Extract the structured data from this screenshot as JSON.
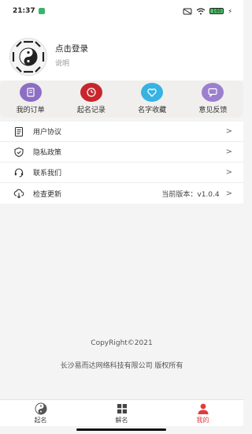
{
  "status_bar": {
    "time": "21:37",
    "battery": "100"
  },
  "profile": {
    "login_label": "点击登录",
    "description": "说明",
    "avatar_icon": "bagua-avatar-icon"
  },
  "quick_actions": [
    {
      "label": "我的订单",
      "icon": "order-icon",
      "color": "#8c6fc4"
    },
    {
      "label": "起名记录",
      "icon": "clock-icon",
      "color": "#c8262c"
    },
    {
      "label": "名字收藏",
      "icon": "heart-icon",
      "color": "#37b3e2"
    },
    {
      "label": "意见反馈",
      "icon": "feedback-icon",
      "color": "#9c7fcf"
    }
  ],
  "menu": [
    {
      "label": "用户协议",
      "icon": "document-icon",
      "value": ""
    },
    {
      "label": "隐私政策",
      "icon": "shield-icon",
      "value": ""
    },
    {
      "label": "联系我们",
      "icon": "headset-icon",
      "value": ""
    },
    {
      "label": "检查更新",
      "icon": "cloud-download-icon",
      "value": "当前版本：v1.0.4"
    }
  ],
  "footer": {
    "copyright": "CopyRight©2021",
    "company": "长沙易而达网络科技有限公司 版权所有"
  },
  "tabs": [
    {
      "label": "起名",
      "icon": "taiji-icon",
      "active": false
    },
    {
      "label": "解名",
      "icon": "grid-icon",
      "active": false
    },
    {
      "label": "我的",
      "icon": "user-icon",
      "active": true
    }
  ],
  "colors": {
    "accent": "#e23a3a",
    "order": "#8c6fc4",
    "history": "#c8262c",
    "favorite": "#37b3e2",
    "feedback": "#9c7fcf"
  }
}
